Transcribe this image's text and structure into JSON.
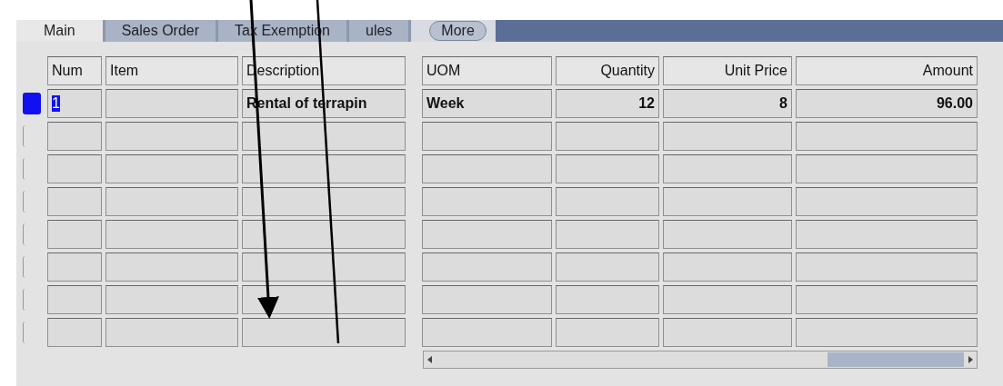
{
  "tabs": [
    {
      "label": "Main",
      "selected": true
    },
    {
      "label": "Sales Order",
      "selected": false
    },
    {
      "label": "Tax Exemption",
      "selected": false
    },
    {
      "label": "ules",
      "selected": false
    },
    {
      "label": "More",
      "kind": "more",
      "selected": false
    }
  ],
  "table": {
    "columns": [
      {
        "label": "Num"
      },
      {
        "label": "Item"
      },
      {
        "label": "Description"
      },
      {
        "label": "UOM"
      },
      {
        "label": "Quantity"
      },
      {
        "label": "Unit Price"
      },
      {
        "label": "Amount"
      }
    ],
    "rows": [
      {
        "selected": true,
        "cells": [
          "1",
          "",
          "Rental of terrapin",
          "Week",
          "12",
          "8",
          "96.00"
        ]
      },
      {
        "selected": false
      },
      {
        "selected": false
      },
      {
        "selected": false
      },
      {
        "selected": false
      },
      {
        "selected": false
      },
      {
        "selected": false
      },
      {
        "selected": false
      }
    ]
  }
}
